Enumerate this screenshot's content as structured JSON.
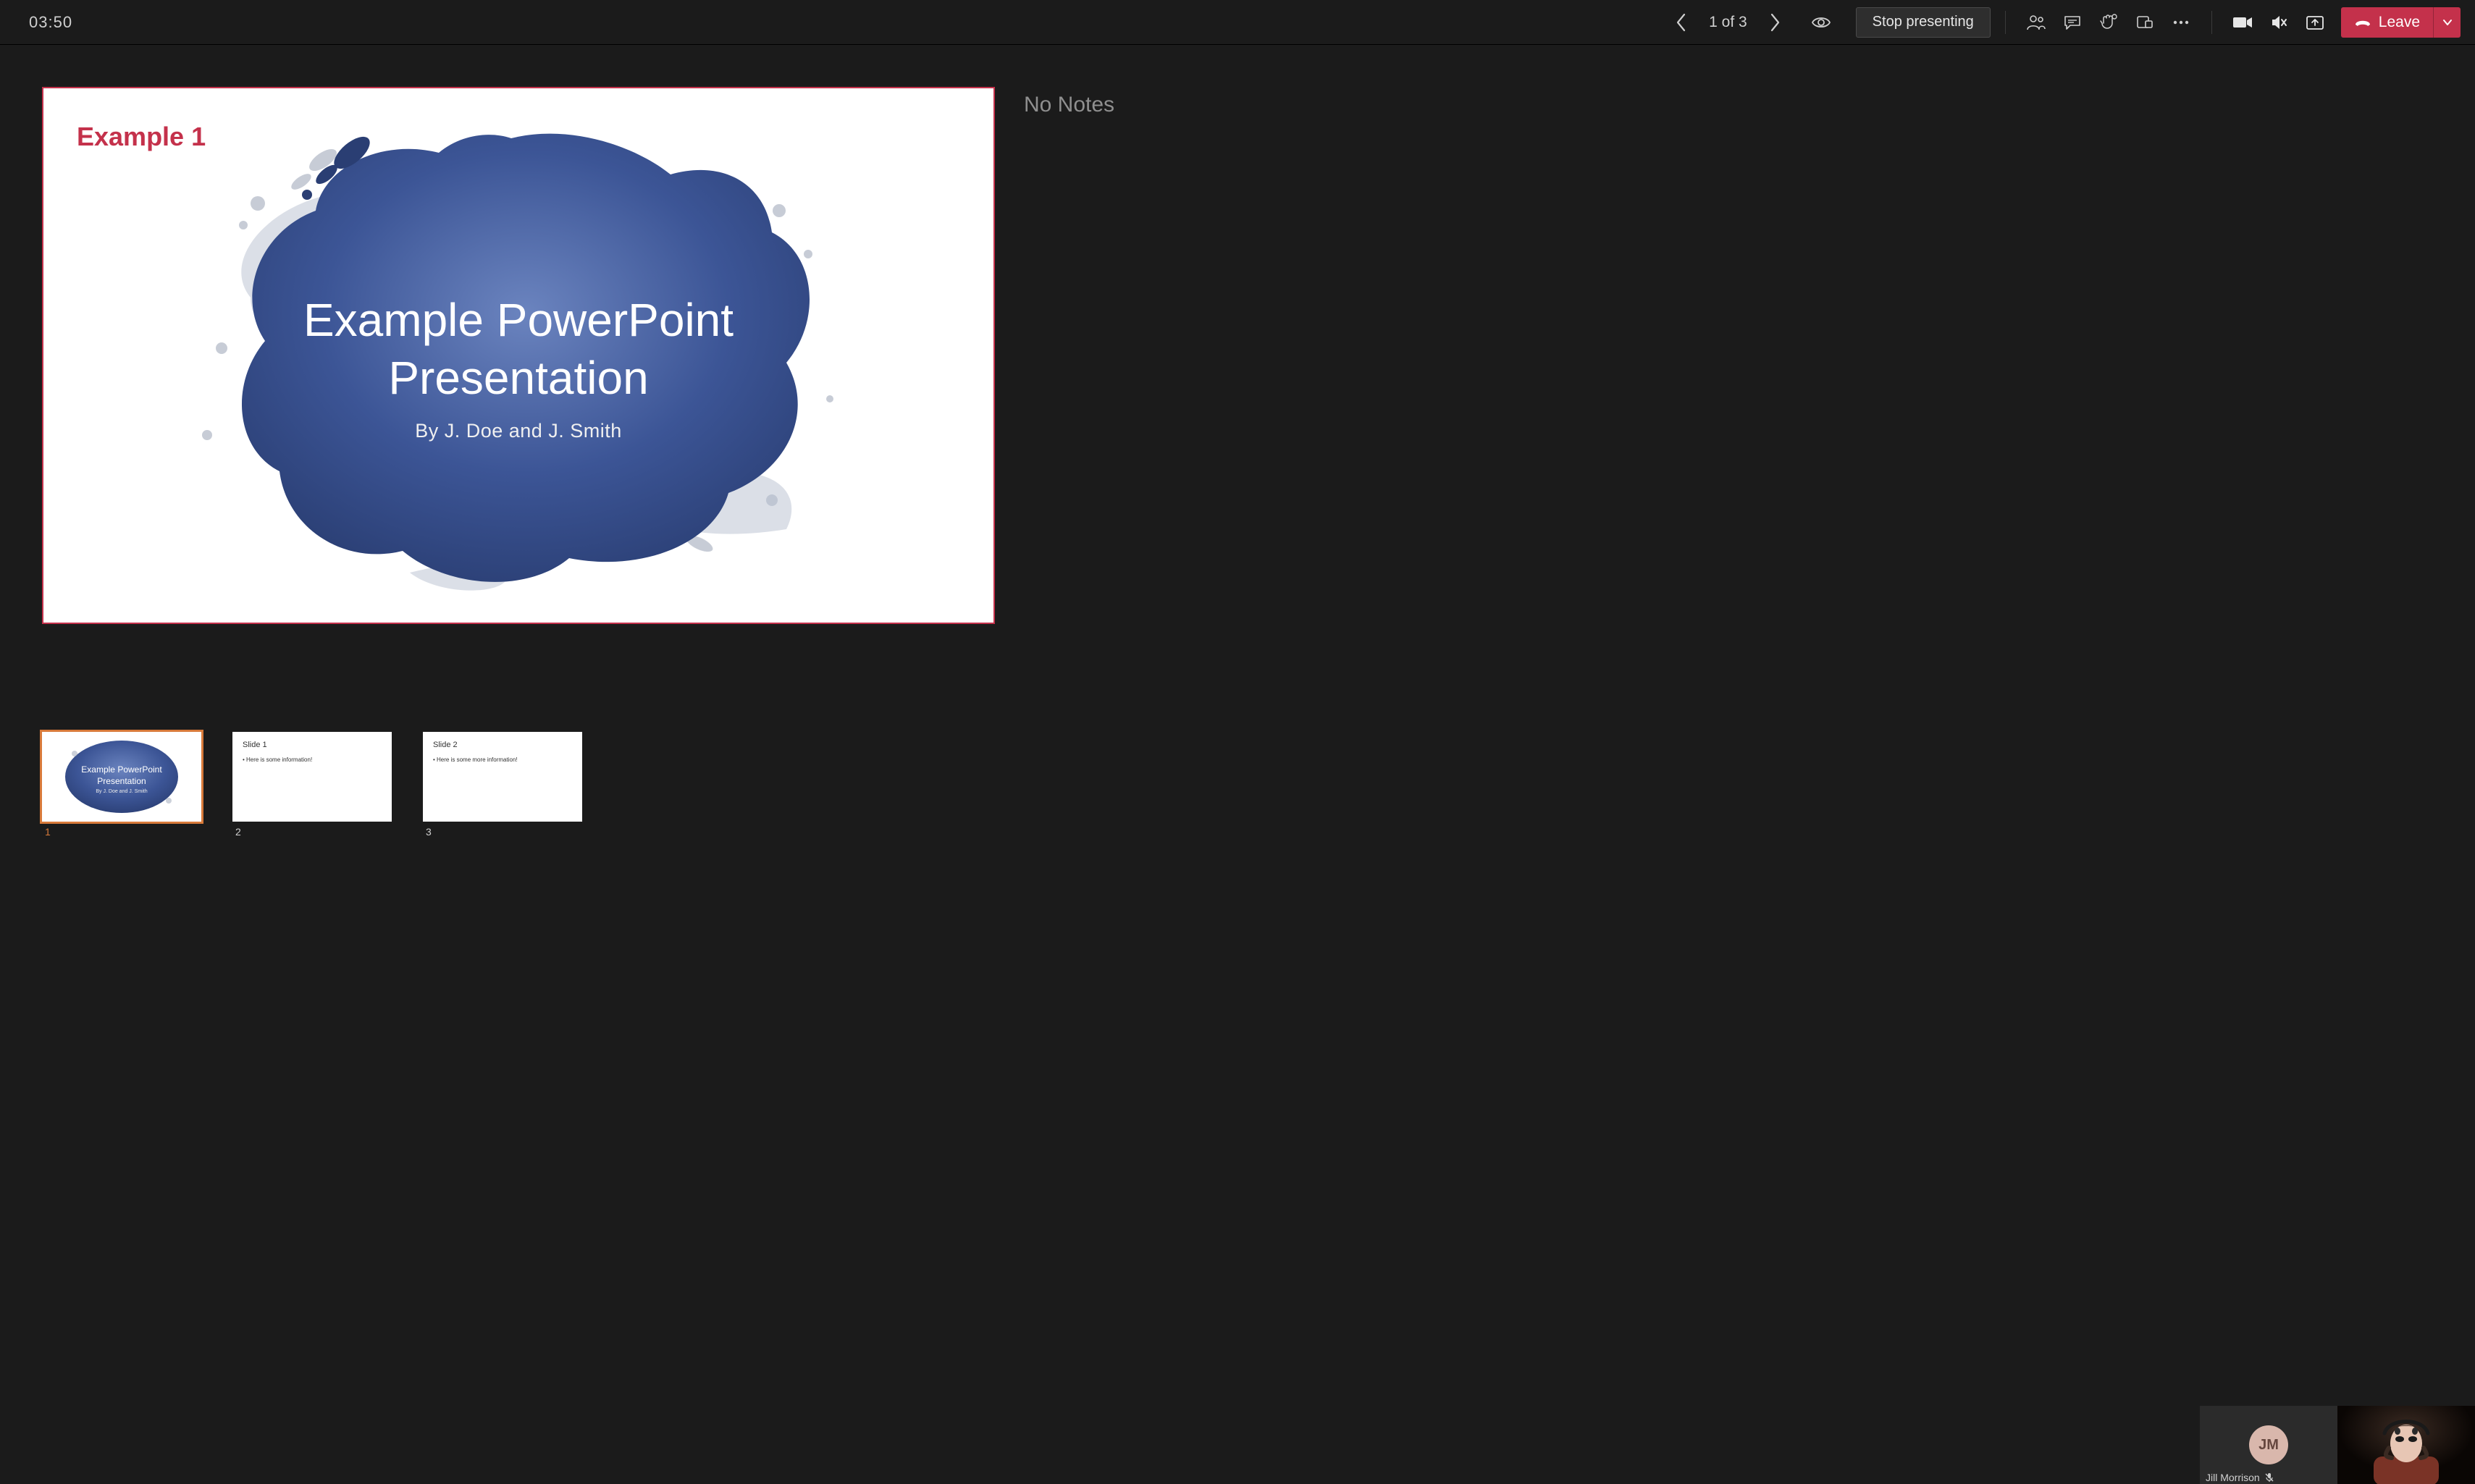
{
  "timer": "03:50",
  "nav": {
    "page_indicator": "1 of 3",
    "stop_label": "Stop presenting",
    "leave_label": "Leave"
  },
  "slide": {
    "watermark": "Example 1",
    "title_line1": "Example PowerPoint",
    "title_line2": "Presentation",
    "subtitle": "By J. Doe and J. Smith"
  },
  "notes": {
    "empty_label": "No Notes"
  },
  "thumbnails": [
    {
      "num": "1",
      "kind": "title",
      "title_l1": "Example PowerPoint",
      "title_l2": "Presentation",
      "sub": "By J. Doe and J. Smith",
      "active": true
    },
    {
      "num": "2",
      "kind": "text",
      "heading": "Slide 1",
      "bullet": "• Here is some information!",
      "active": false
    },
    {
      "num": "3",
      "kind": "text",
      "heading": "Slide 2",
      "bullet": "• Here is some more information!",
      "active": false
    }
  ],
  "participants": {
    "avatar_initials": "JM",
    "avatar_name": "Jill Morrison"
  }
}
